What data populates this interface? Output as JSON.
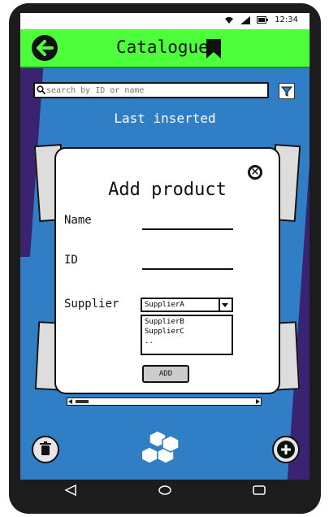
{
  "status_bar": {
    "time": "12:34",
    "wifi_icon": "wifi-icon",
    "signal_icon": "signal-icon",
    "battery_icon": "battery-icon"
  },
  "app_bar": {
    "title": "Catalogue",
    "back_icon": "arrow-left-icon",
    "bookmark_icon": "bookmark-icon",
    "color": "#4cff3a"
  },
  "search": {
    "placeholder": "search by ID or name",
    "value": ""
  },
  "section": {
    "heading": "Last inserted"
  },
  "modal": {
    "title": "Add product",
    "fields": {
      "name_label": "Name",
      "id_label": "ID",
      "supplier_label": "Supplier"
    },
    "supplier_select": {
      "selected": "SupplierA",
      "options": [
        "SupplierB",
        "SupplierC",
        ".."
      ]
    },
    "add_button": "ADD"
  },
  "bottom_bar": {
    "delete_icon": "trash-icon",
    "logo_icon": "cubes-icon",
    "add_icon": "plus-icon"
  },
  "colors": {
    "accent": "#4cff3a",
    "background": "#3a2370",
    "stripe": "#2f7ec6"
  }
}
